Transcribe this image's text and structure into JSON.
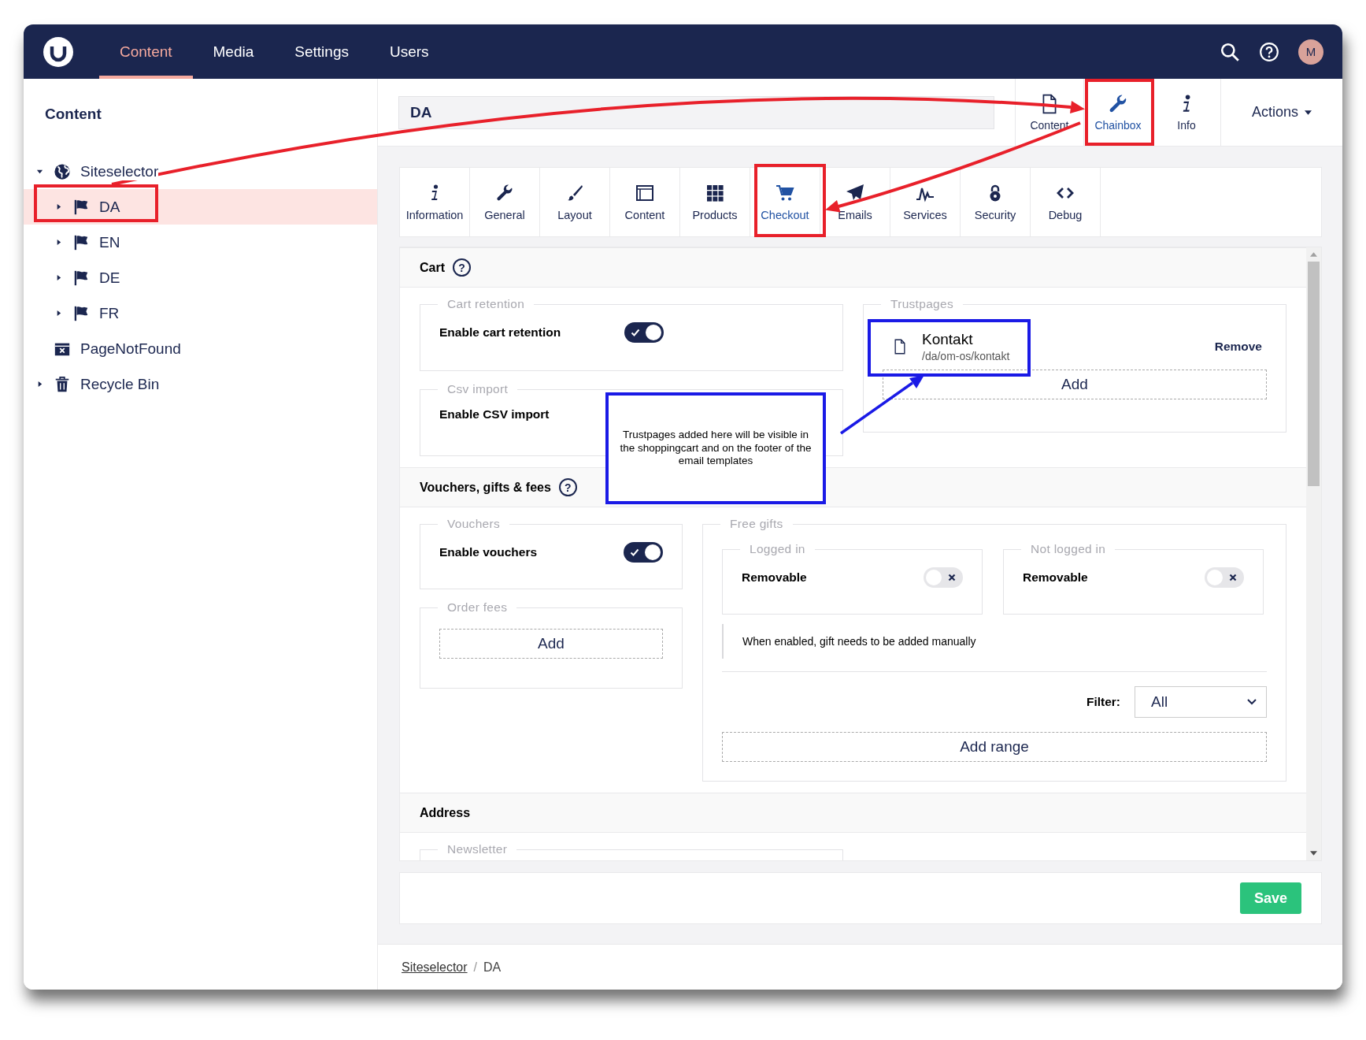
{
  "top_nav": {
    "items": [
      {
        "label": "Content",
        "selected": true
      },
      {
        "label": "Media",
        "selected": false
      },
      {
        "label": "Settings",
        "selected": false
      },
      {
        "label": "Users",
        "selected": false
      }
    ],
    "avatar": "M"
  },
  "sidebar": {
    "title": "Content",
    "tree": [
      {
        "label": "Siteselector",
        "expanded": true,
        "selected": false,
        "children": [
          {
            "label": "DA",
            "expanded": false,
            "selected": true
          },
          {
            "label": "EN",
            "expanded": false,
            "selected": false
          },
          {
            "label": "DE",
            "expanded": false,
            "selected": false
          },
          {
            "label": "FR",
            "expanded": false,
            "selected": false
          }
        ]
      },
      {
        "label": "PageNotFound",
        "selected": false
      },
      {
        "label": "Recycle Bin",
        "expanded": false,
        "selected": false
      }
    ]
  },
  "editor": {
    "name": "DA",
    "apps": [
      {
        "label": "Content",
        "selected": false
      },
      {
        "label": "Chainbox",
        "selected": true
      },
      {
        "label": "Info",
        "selected": false
      }
    ],
    "actions": "Actions"
  },
  "tabs": [
    {
      "label": "Information",
      "selected": false
    },
    {
      "label": "General",
      "selected": false
    },
    {
      "label": "Layout",
      "selected": false
    },
    {
      "label": "Content",
      "selected": false
    },
    {
      "label": "Products",
      "selected": false
    },
    {
      "label": "Checkout",
      "selected": true
    },
    {
      "label": "Emails",
      "selected": false
    },
    {
      "label": "Services",
      "selected": false
    },
    {
      "label": "Security",
      "selected": false
    },
    {
      "label": "Debug",
      "selected": false
    }
  ],
  "cart": {
    "title": "Cart",
    "help": "?",
    "cart_retention": {
      "legend": "Cart retention",
      "label": "Enable cart retention",
      "on": true
    },
    "csv_import": {
      "legend": "Csv import",
      "label": "Enable CSV import"
    },
    "trustpages": {
      "legend": "Trustpages",
      "items": [
        {
          "name": "Kontakt",
          "path": "/da/om-os/kontakt",
          "remove": "Remove"
        }
      ],
      "add": "Add"
    }
  },
  "vouchers": {
    "title": "Vouchers, gifts & fees",
    "help": "?",
    "vouchers": {
      "legend": "Vouchers",
      "label": "Enable vouchers",
      "on": true
    },
    "order_fees": {
      "legend": "Order fees",
      "add": "Add"
    },
    "free_gifts": {
      "legend": "Free gifts",
      "groups": [
        {
          "legend": "Logged in",
          "label": "Removable",
          "on": false
        },
        {
          "legend": "Not logged in",
          "label": "Removable",
          "on": false
        }
      ],
      "hint": "When enabled, gift needs to be added manually",
      "filter_label": "Filter:",
      "filter_value": "All",
      "add_range": "Add range"
    }
  },
  "address": {
    "title": "Address",
    "newsletter_legend": "Newsletter"
  },
  "save": "Save",
  "breadcrumb": {
    "separator": "/",
    "items": [
      {
        "label": "Siteselector",
        "link": true
      },
      {
        "label": "DA",
        "link": false
      }
    ]
  },
  "callout": "Trustpages added here will be visible in the shoppingcart and on the footer of the email templates"
}
